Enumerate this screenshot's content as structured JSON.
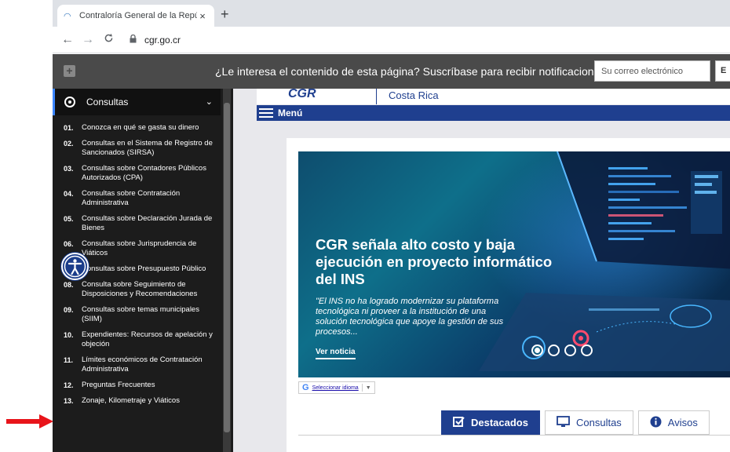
{
  "browser": {
    "tab_title": "Contraloría General de la Repúbli",
    "tab_close": "×",
    "new_tab": "+",
    "url": "cgr.go.cr",
    "back_icon": "←",
    "forward_icon": "→",
    "reload_icon": "C"
  },
  "notification": {
    "plus": "+",
    "message": "¿Le interesa el contenido de esta página? Suscríbase para recibir notificaciones!",
    "email_placeholder": "Su correo electrónico",
    "send_label": "E"
  },
  "sidebar": {
    "header_label": "Consultas",
    "chevron": "⌄",
    "items": [
      {
        "num": "01.",
        "label": "Conozca en qué se gasta su dinero"
      },
      {
        "num": "02.",
        "label": "Consultas en el Sistema de Registro de Sancionados (SIRSA)"
      },
      {
        "num": "03.",
        "label": "Consultas sobre Contadores Públicos Autorizados (CPA)"
      },
      {
        "num": "04.",
        "label": "Consultas sobre Contratación Administrativa"
      },
      {
        "num": "05.",
        "label": "Consultas sobre Declaración Jurada de Bienes"
      },
      {
        "num": "06.",
        "label": "Consultas sobre Jurisprudencia de Viáticos"
      },
      {
        "num": "07.",
        "label": "Consultas sobre Presupuesto Público"
      },
      {
        "num": "08.",
        "label": "Consulta sobre Seguimiento de Disposiciones y Recomendaciones"
      },
      {
        "num": "09.",
        "label": "Consultas sobre temas municipales (SIIM)"
      },
      {
        "num": "10.",
        "label": "Expendientes: Recursos de apelación y objeción"
      },
      {
        "num": "11.",
        "label": "Límites económicos de Contratación Administrativa"
      },
      {
        "num": "12.",
        "label": "Preguntas Frecuentes"
      },
      {
        "num": "13.",
        "label": "Zonaje, Kilometraje y Viáticos"
      }
    ]
  },
  "site": {
    "logo": "CGR",
    "country": "Costa Rica",
    "menu_label": "Menú"
  },
  "hero": {
    "title": "CGR señala alto costo y baja ejecución en proyecto informático del INS",
    "subtitle": "\"El INS no ha logrado modernizar su plataforma tecnológica ni proveer a la institución de una solución tecnológica que apoye la gestión de sus procesos...",
    "link": "Ver noticia",
    "slides_count": 4,
    "active_slide": 1
  },
  "translate": {
    "label": "Seleccionar idioma",
    "arrow": "▼"
  },
  "content_tabs": [
    {
      "label": "Destacados",
      "icon": "checkbox-icon",
      "active": true
    },
    {
      "label": "Consultas",
      "icon": "monitor-icon",
      "active": false
    },
    {
      "label": "Avisos",
      "icon": "info-icon",
      "active": false
    }
  ],
  "colors": {
    "brand_blue": "#1f3f8f",
    "sidebar_bg": "#1c1c1c",
    "notif_bg": "#4a4a4a",
    "annotation_red": "#e8141a"
  }
}
